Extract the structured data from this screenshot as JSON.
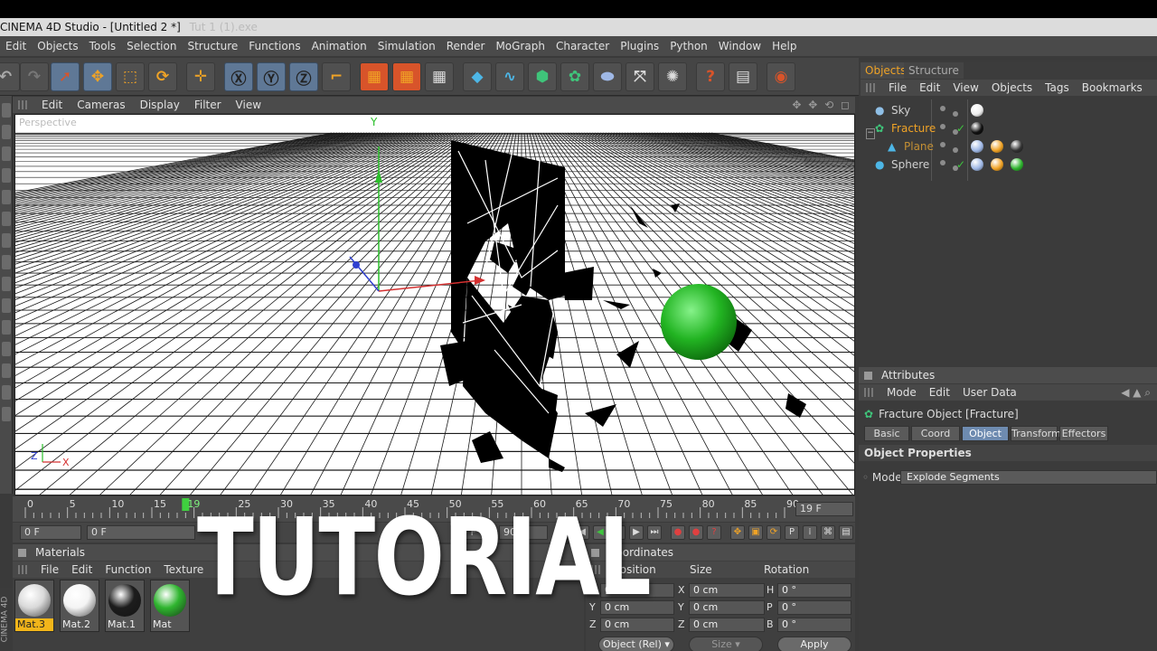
{
  "window": {
    "title": "CINEMA 4D Studio - [Untitled 2 *]",
    "ghost_title": "Tut 1 (1).exe"
  },
  "menu": [
    "Edit",
    "Objects",
    "Tools",
    "Selection",
    "Structure",
    "Functions",
    "Animation",
    "Simulation",
    "Render",
    "MoGraph",
    "Character",
    "Plugins",
    "Python",
    "Window",
    "Help"
  ],
  "viewport": {
    "menu": [
      "Edit",
      "Cameras",
      "Display",
      "Filter",
      "View"
    ],
    "label": "Perspective",
    "axis_y": "Y",
    "axis_x": "X",
    "axis_z": "Z",
    "nav_icons": "✥ ✥ ⟲ ◻"
  },
  "timeline": {
    "ticks": [
      "0",
      "5",
      "10",
      "15",
      "19",
      "25",
      "30",
      "35",
      "40",
      "45",
      "50",
      "55",
      "60",
      "65",
      "70",
      "75",
      "80",
      "85",
      "90"
    ],
    "current_frame": "19 F",
    "start_field": "0 F",
    "min_field": "0 F",
    "end_field": "90 F",
    "max_field": "90 F"
  },
  "materials": {
    "title": "Materials",
    "menu": [
      "File",
      "Edit",
      "Function",
      "Texture"
    ],
    "items": [
      {
        "label": "Mat.3",
        "color": "#d9d9d9",
        "active": true
      },
      {
        "label": "Mat.2",
        "color": "#f4f4f4",
        "active": false
      },
      {
        "label": "Mat.1",
        "color": "#1d1d1d",
        "active": false
      },
      {
        "label": "Mat",
        "color": "#2fb52f",
        "active": false
      }
    ]
  },
  "coordinates": {
    "title": "Coordinates",
    "headers": [
      "Position",
      "Size",
      "Rotation"
    ],
    "rows": [
      {
        "a": "X",
        "pos": "0 cm",
        "b": "X",
        "size": "0 cm",
        "c": "H",
        "rot": "0 °"
      },
      {
        "a": "Y",
        "pos": "0 cm",
        "b": "Y",
        "size": "0 cm",
        "c": "P",
        "rot": "0 °"
      },
      {
        "a": "Z",
        "pos": "0 cm",
        "b": "Z",
        "size": "0 cm",
        "c": "B",
        "rot": "0 °"
      }
    ],
    "mode": "Object (Rel)",
    "size_mode": "Size",
    "apply": "Apply"
  },
  "objects_panel": {
    "tabs": [
      "Objects",
      "Structure"
    ],
    "menu": [
      "File",
      "Edit",
      "View",
      "Objects",
      "Tags",
      "Bookmarks"
    ],
    "items": [
      {
        "name": "Sky",
        "indent": 0,
        "color": "#d0d0d0"
      },
      {
        "name": "Fracture",
        "indent": 0,
        "color": "#f0a326"
      },
      {
        "name": "Plane",
        "indent": 1,
        "color": "#c38f34"
      },
      {
        "name": "Sphere",
        "indent": 0,
        "color": "#d0d0d0"
      }
    ]
  },
  "attributes": {
    "title": "Attributes",
    "menu": [
      "Mode",
      "Edit",
      "User Data"
    ],
    "object_title": "Fracture Object [Fracture]",
    "tabs": [
      "Basic",
      "Coord",
      "Object",
      "Transform",
      "Effectors"
    ],
    "active_tab": "Object",
    "section": "Object Properties",
    "mode_label": "Mode",
    "mode_value": "Explode Segments"
  },
  "overlay_text": "TUTORIAL",
  "brand_vertical": "CINEMA 4D"
}
